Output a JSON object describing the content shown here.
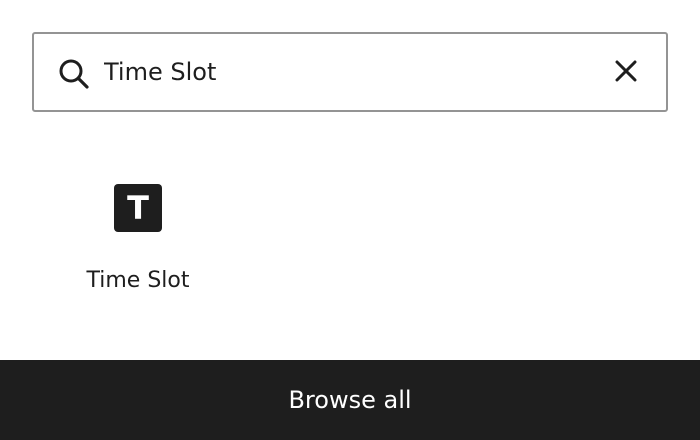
{
  "search": {
    "value": "Time Slot",
    "icon": "search-icon",
    "clear_icon": "close-icon"
  },
  "results": {
    "items": [
      {
        "icon_glyph": "T",
        "icon_name": "text-block-icon",
        "label": "Time Slot"
      }
    ]
  },
  "footer": {
    "browse_all_label": "Browse all"
  },
  "colors": {
    "text": "#1e1e1e",
    "border": "#949494",
    "footer_bg": "#1e1e1e",
    "footer_text": "#ffffff"
  }
}
